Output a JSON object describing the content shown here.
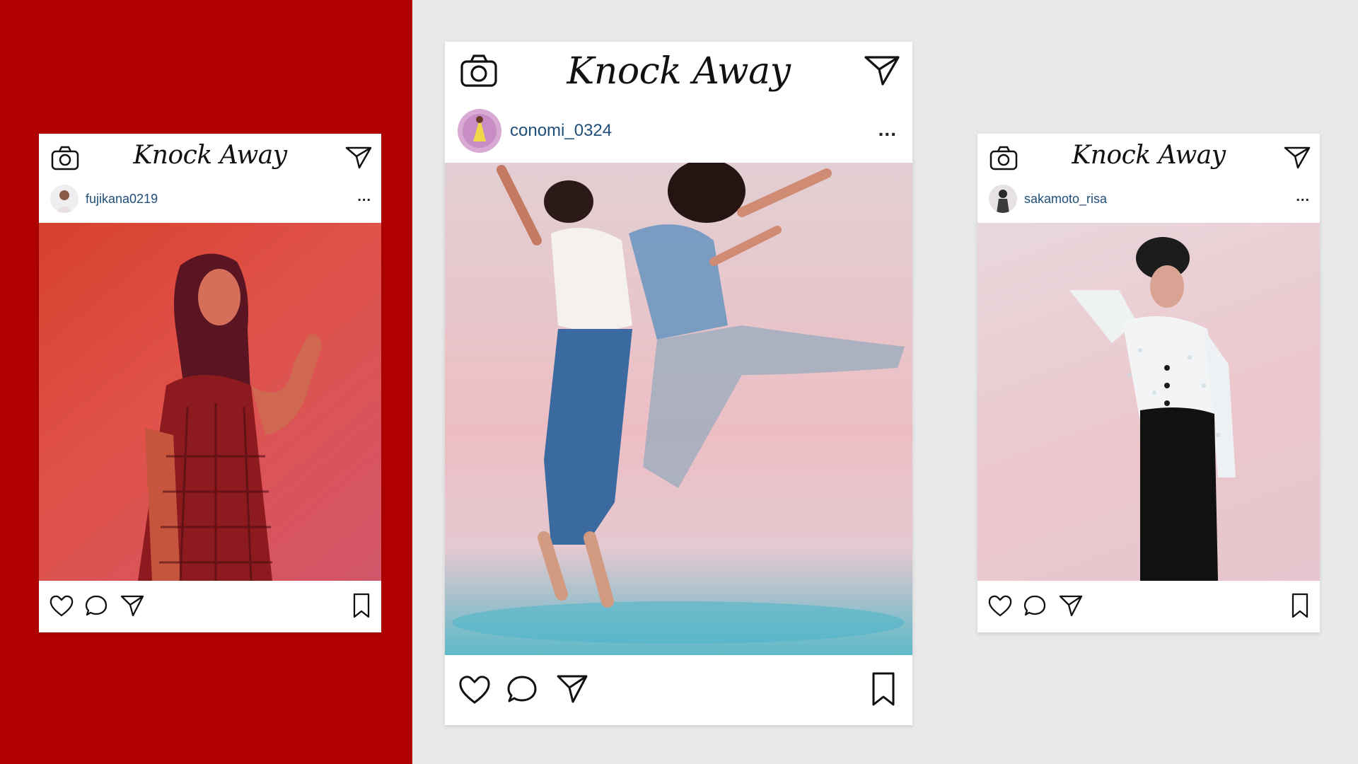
{
  "brand": "Knock Away",
  "colors": {
    "red_panel": "#b10000",
    "background": "#e9e9e9",
    "username": "#1f4e79"
  },
  "icons": {
    "camera": "camera-icon",
    "send": "send-icon",
    "like": "heart-icon",
    "comment": "comment-icon",
    "share": "share-icon",
    "save": "bookmark-icon",
    "more": "more-icon"
  },
  "posts": {
    "left": {
      "username": "fujikana0219",
      "more": "..."
    },
    "center": {
      "username": "conomi_0324",
      "more": "..."
    },
    "right": {
      "username": "sakamoto_risa",
      "more": "..."
    }
  }
}
